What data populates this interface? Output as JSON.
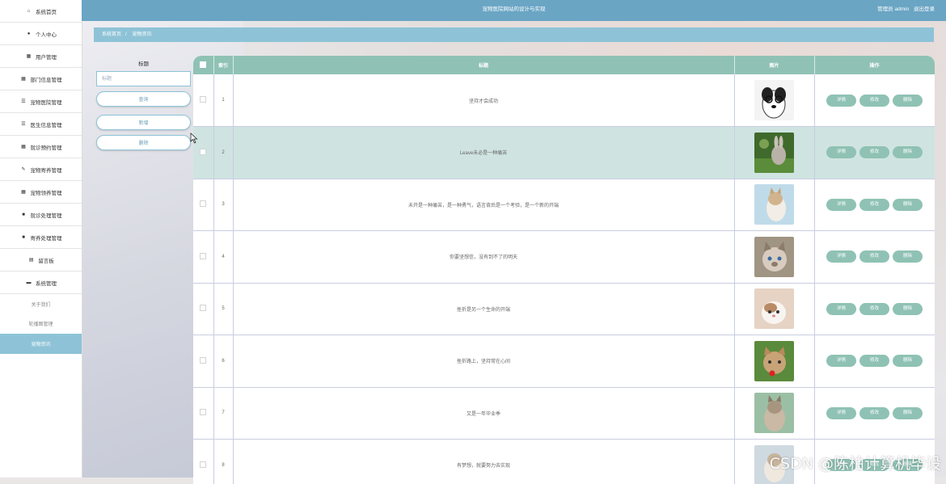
{
  "sidebar": {
    "items": [
      {
        "icon": "home-icon",
        "label": "系统首页"
      },
      {
        "icon": "user-icon",
        "label": "个人中心"
      },
      {
        "icon": "grid-icon",
        "label": "用户管理"
      },
      {
        "icon": "grid-icon",
        "label": "部门信息管理"
      },
      {
        "icon": "list-icon",
        "label": "宠物医院管理"
      },
      {
        "icon": "list-icon",
        "label": "医生信息管理"
      },
      {
        "icon": "grid-icon",
        "label": "就诊预约管理"
      },
      {
        "icon": "edit-icon",
        "label": "宠物寄养管理"
      },
      {
        "icon": "grid-icon",
        "label": "宠物领养管理"
      },
      {
        "icon": "bag-icon",
        "label": "就诊处理管理"
      },
      {
        "icon": "bag-icon",
        "label": "寄养处理管理"
      },
      {
        "icon": "message-icon",
        "label": "留言板"
      },
      {
        "icon": "settings-icon",
        "label": "系统管理"
      }
    ],
    "subitems": [
      {
        "label": "关于我们",
        "active": false
      },
      {
        "label": "轮播图管理",
        "active": false
      },
      {
        "label": "宠物资讯",
        "active": true
      }
    ]
  },
  "header": {
    "title": "宠物医院网站的设计与实现",
    "user": "管理员 admin",
    "logout": "退出登录"
  },
  "breadcrumb": {
    "home": "系统首页",
    "sep": "/",
    "current": "宠物资讯"
  },
  "search": {
    "label": "标题",
    "placeholder": "标题",
    "query_btn": "查询",
    "add_btn": "新增",
    "delete_btn": "删除"
  },
  "table": {
    "columns": [
      "",
      "索引",
      "标题",
      "图片",
      "操作"
    ],
    "rows": [
      {
        "index": "1",
        "title": "坚持才会成功",
        "img": "dog",
        "highlight": false
      },
      {
        "index": "2",
        "title": "Leave未必是一种痛苦",
        "img": "rabbit",
        "highlight": true
      },
      {
        "index": "3",
        "title": "未开是一种痛苦，是一种勇气，语言背后是一个考验，是一个新的开端",
        "img": "cat1",
        "highlight": false
      },
      {
        "index": "4",
        "title": "你要坚想信，没有到不了的明天",
        "img": "cat2",
        "highlight": false
      },
      {
        "index": "5",
        "title": "挫折是另一个生命的开端",
        "img": "cat3",
        "highlight": false
      },
      {
        "index": "6",
        "title": "挫折路上，坚持常在心间",
        "img": "cat4",
        "highlight": false
      },
      {
        "index": "7",
        "title": "又是一年毕业季",
        "img": "cat5",
        "highlight": false
      },
      {
        "index": "8",
        "title": "有梦想，就要努力去实现",
        "img": "cat6",
        "highlight": false
      }
    ],
    "actions": {
      "detail": "详情",
      "edit": "修改",
      "delete": "删除"
    }
  },
  "watermark": "CSDN @陈柏计算机毕设"
}
